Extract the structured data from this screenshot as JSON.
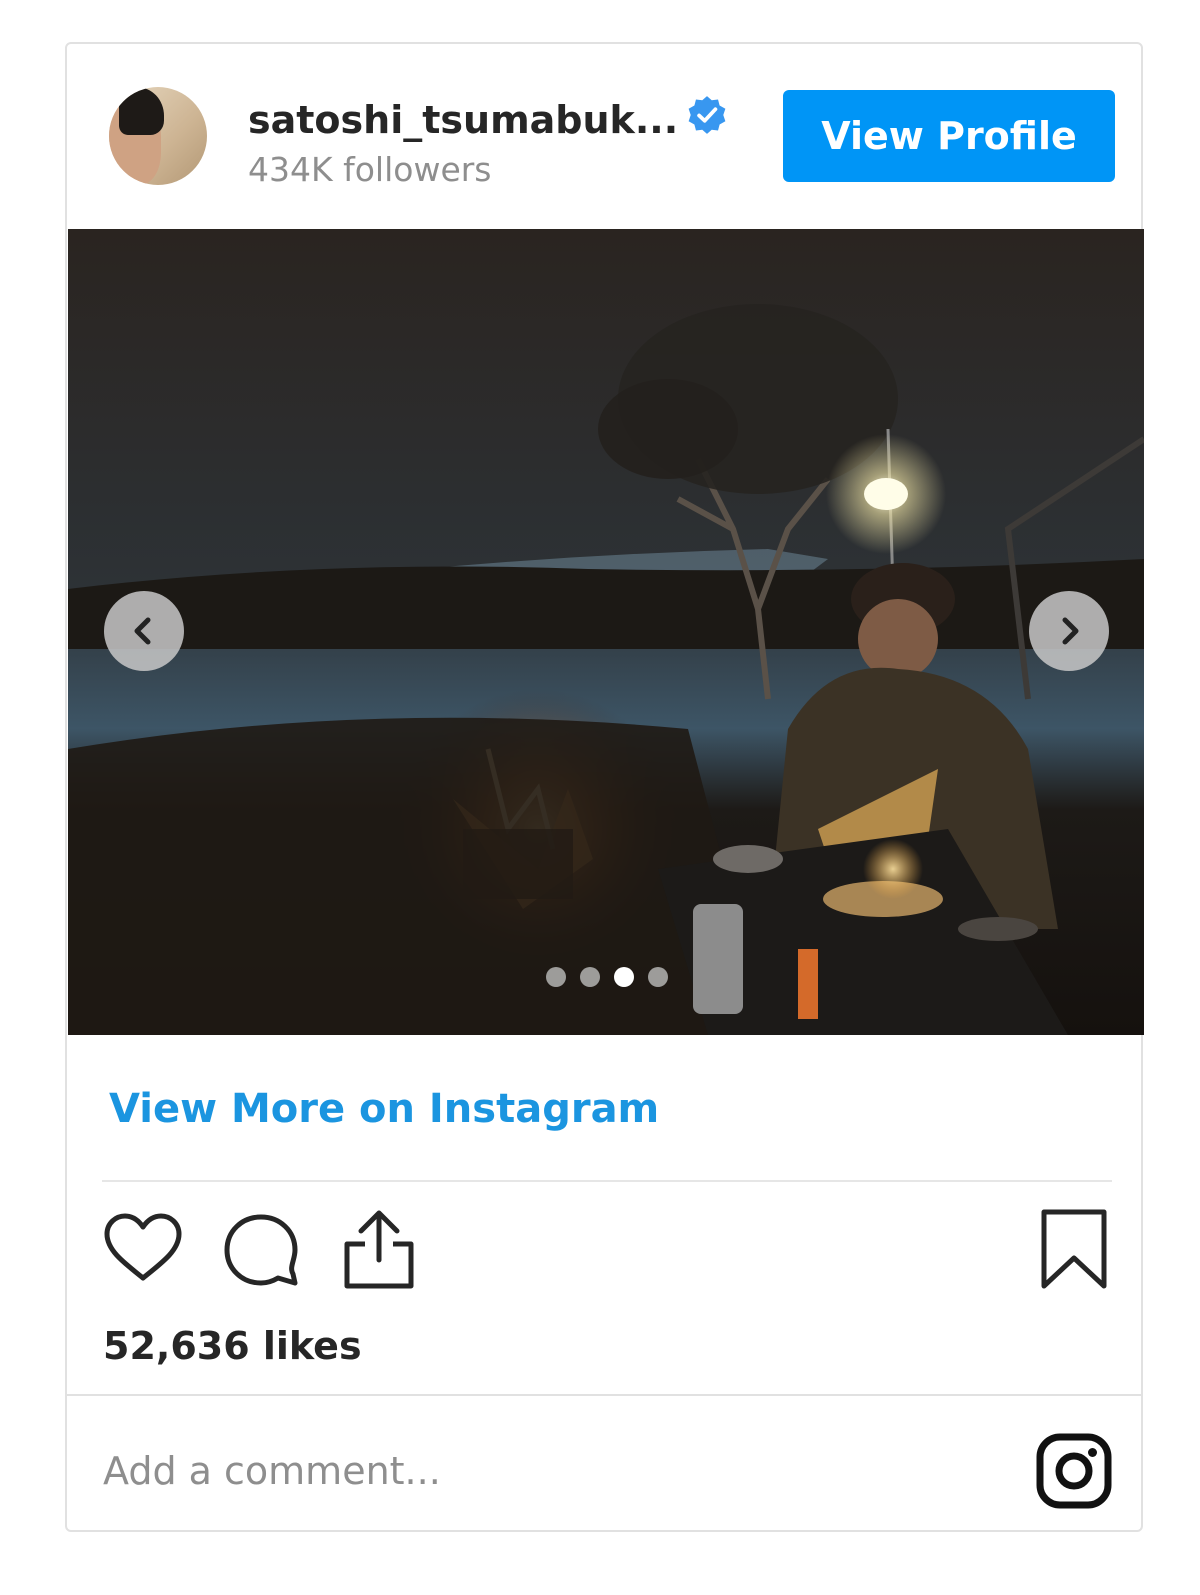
{
  "header": {
    "username": "satoshi_tsumabuk...",
    "followers": "434K followers",
    "view_profile_label": "View Profile"
  },
  "carousel": {
    "total_slides": 4,
    "active_slide": 3
  },
  "view_more_label": "View More on Instagram",
  "likes": "52,636 likes",
  "comment": {
    "placeholder": "Add a comment..."
  },
  "colors": {
    "accent": "#0095f6",
    "link": "#1b95e0"
  },
  "icons": [
    "verified-badge-icon",
    "chevron-left-icon",
    "chevron-right-icon",
    "heart-icon",
    "comment-icon",
    "share-icon",
    "bookmark-icon",
    "instagram-logo-icon"
  ]
}
